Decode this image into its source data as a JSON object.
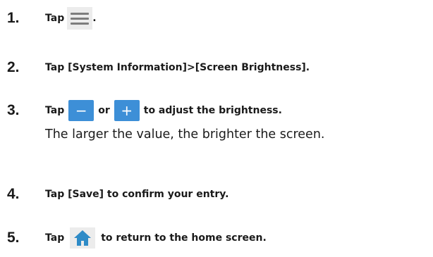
{
  "steps": [
    {
      "number": "1.",
      "before": "Tap",
      "icon": "hamburger-menu-icon",
      "after": "."
    },
    {
      "number": "2.",
      "text": "Tap [System Information]>[Screen Brightness]."
    },
    {
      "number": "3.",
      "before": "Tap",
      "icon_minus": "minus-button-icon",
      "icon_minus_glyph": "−",
      "middle": "or",
      "icon_plus": "plus-button-icon",
      "icon_plus_glyph": "+",
      "after": "to adjust the brightness.",
      "note": "The larger the value, the brighter the screen."
    },
    {
      "number": "4.",
      "text": "Tap [Save] to confirm your entry."
    },
    {
      "number": "5.",
      "before": "Tap",
      "icon": "home-icon",
      "after": "to return to the home screen."
    }
  ],
  "colors": {
    "button_blue": "#3d8fd7",
    "icon_bg": "#ececec",
    "icon_gray": "#7d7d7d"
  }
}
